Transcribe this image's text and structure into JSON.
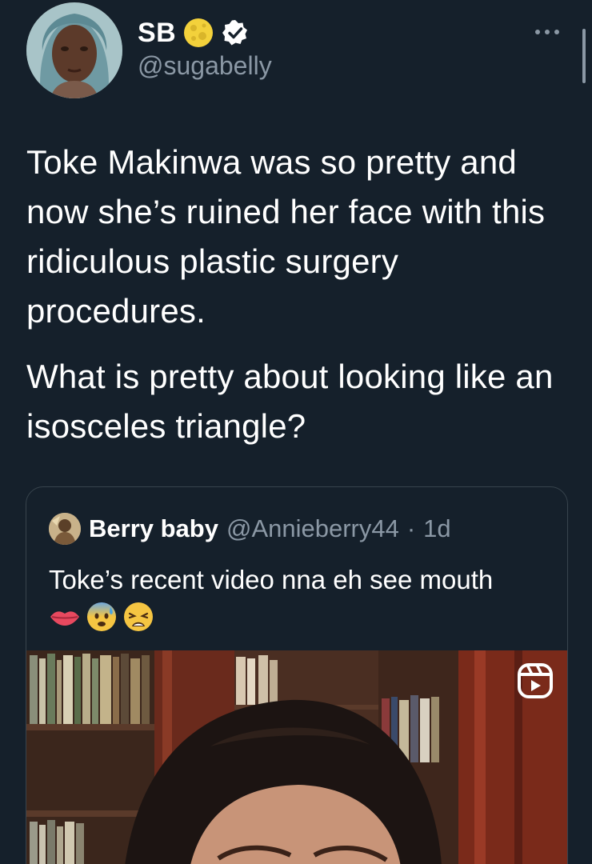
{
  "user": {
    "display_name": "SB",
    "handle": "@sugabelly",
    "verified": true
  },
  "tweet": {
    "paragraphs": [
      "Toke Makinwa was so pretty and now she’s ruined her face with this ridiculous plastic surgery procedures.",
      "What is pretty about looking like an isosceles triangle?"
    ]
  },
  "quoted": {
    "display_name": "Berry baby",
    "handle": "@Annieberry44",
    "separator": "·",
    "time": "1d",
    "text": "Toke’s recent video nna eh see mouth",
    "emojis": [
      "lips-emoji",
      "anxious-face-emoji",
      "weary-face-emoji"
    ],
    "media_type": "video",
    "media_badge": "reels-icon"
  },
  "colors": {
    "background": "#15202b",
    "text": "#ffffff",
    "secondary_text": "#8b98a5",
    "border": "#38444d",
    "verified_badge": "#ffffff"
  }
}
